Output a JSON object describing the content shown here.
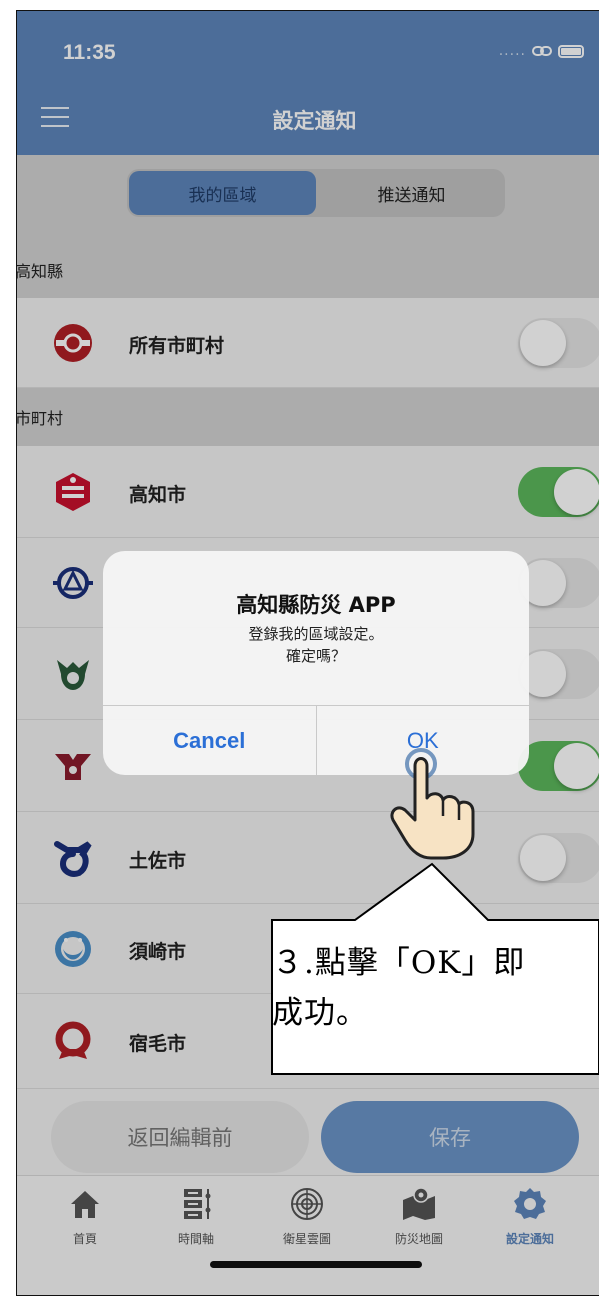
{
  "status_bar": {
    "time": "11:35",
    "dots": "....."
  },
  "nav": {
    "title": "設定通知"
  },
  "segment": {
    "tab_my_area": "我的區域",
    "tab_push": "推送通知"
  },
  "sections": [
    {
      "header": "高知縣"
    },
    {
      "header": "市町村"
    }
  ],
  "rows": [
    {
      "name": "所有市町村",
      "on": false
    },
    {
      "name": "高知市",
      "on": true
    },
    {
      "name": "",
      "on": false
    },
    {
      "name": "",
      "on": false
    },
    {
      "name": "",
      "on": true
    },
    {
      "name": "土佐市",
      "on": false
    },
    {
      "name": "須崎市",
      "on": false
    },
    {
      "name": "宿毛市",
      "on": false
    }
  ],
  "buttons": {
    "back": "返回編輯前",
    "save": "保存"
  },
  "tabs": [
    {
      "label": "首頁",
      "icon": "home-icon"
    },
    {
      "label": "時間軸",
      "icon": "timeline-icon"
    },
    {
      "label": "衛星雲圖",
      "icon": "satellite-icon"
    },
    {
      "label": "防災地圖",
      "icon": "map-icon"
    },
    {
      "label": "設定通知",
      "icon": "gear-icon"
    }
  ],
  "alert": {
    "title": "高知縣防災 APP",
    "message_line1": "登錄我的區域設定。",
    "message_line2": "確定嗎？",
    "cancel": "Cancel",
    "ok": "OK"
  },
  "callout": {
    "line1": "３.點擊「OK」即",
    "line2": "成功。"
  },
  "colors": {
    "header_blue": "#5d86bb",
    "toggle_on": "#5cb85c",
    "alert_button": "#2b6fd6"
  }
}
